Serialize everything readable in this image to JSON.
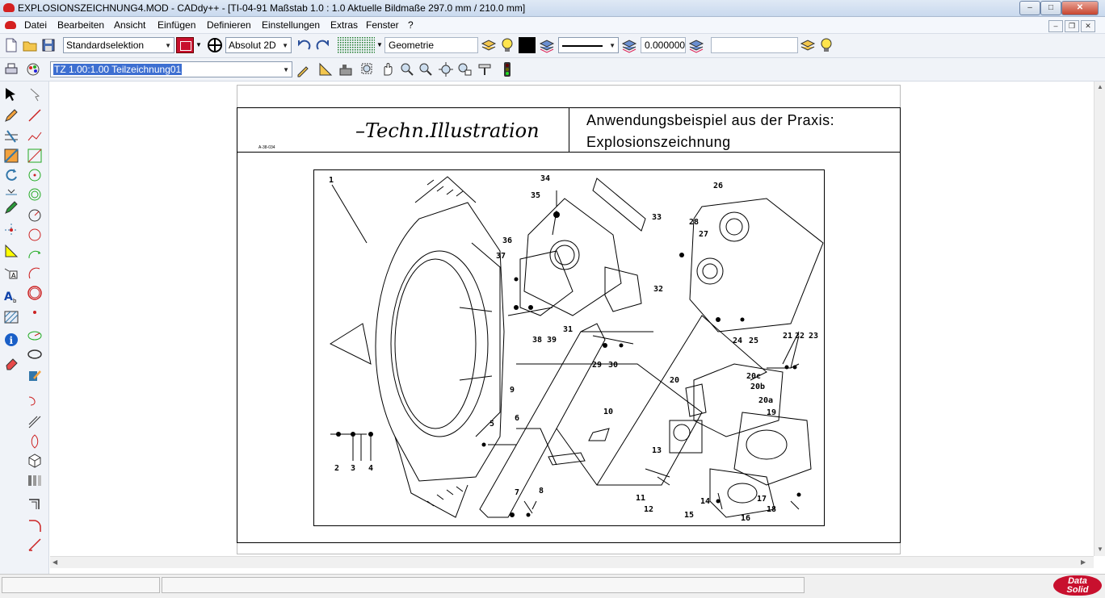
{
  "window": {
    "title": "EXPLOSIONSZEICHNUNG4.MOD  -  CADdy++ - [TI-04-91    Maßstab 1.0 : 1.0    Aktuelle Bildmaße 297.0 mm / 210.0 mm]",
    "min": "–",
    "max": "□",
    "close": "✕",
    "mdi_min": "–",
    "mdi_max": "❐",
    "mdi_close": "✕"
  },
  "menu": {
    "items": [
      "Datei",
      "Bearbeiten",
      "Ansicht",
      "Einfügen",
      "Definieren",
      "Einstellungen",
      "Extras",
      "Fenster",
      "?"
    ]
  },
  "toolbar1": {
    "selection_mode": "Standardselektion",
    "coord_mode": "Absolut 2D",
    "layer_name": "Geometrie",
    "line_width": "0.000000",
    "extra_field": ""
  },
  "toolbar2": {
    "drawing_name": "TZ 1.00:1.00 Teilzeichnung01"
  },
  "sheet": {
    "title": "–Techn.Illustration",
    "small_text": "A-38-034",
    "desc_line1": "Anwendungsbeispiel aus der Praxis:",
    "desc_line2": "Explosionszeichnung"
  },
  "labels": [
    "1",
    "2",
    "3",
    "4",
    "5",
    "6",
    "7",
    "8",
    "9",
    "10",
    "11",
    "12",
    "13",
    "14",
    "15",
    "16",
    "17",
    "18",
    "19",
    "20",
    "20a",
    "20b",
    "20c",
    "21",
    "22",
    "23",
    "24",
    "25",
    "26",
    "27",
    "28",
    "29",
    "30",
    "31",
    "32",
    "33",
    "34",
    "35",
    "36",
    "37",
    "38",
    "39"
  ],
  "colors": {
    "title_bar": "#c9d9ee",
    "toolbar": "#f0f3f8",
    "accent_red": "#c8102e",
    "selection": "#3d6fd1"
  },
  "status": {
    "logo_line1": "Data",
    "logo_line2": "Solid"
  }
}
